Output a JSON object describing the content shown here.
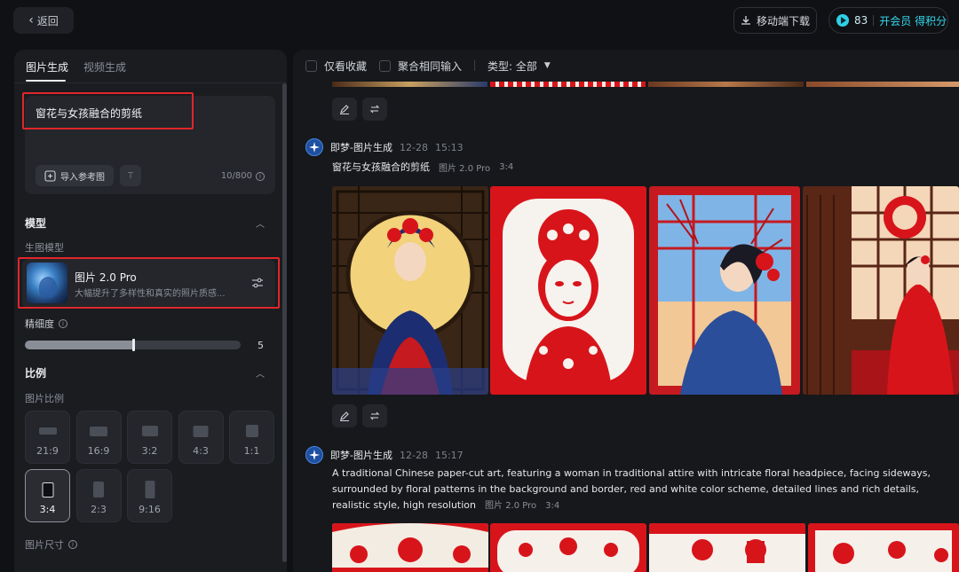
{
  "topbar": {
    "back_label": "返回",
    "mobile_download": "移动端下载",
    "credits": "83",
    "member_label": "开会员 得积分"
  },
  "left": {
    "tabs": [
      "图片生成",
      "视频生成"
    ],
    "prompt": "窗花与女孩融合的剪纸",
    "import_label": "导入参考图",
    "text_button": "T",
    "char_count": "10/800",
    "model_section": "模型",
    "model_sublabel": "生图模型",
    "model": {
      "name": "图片 2.0 Pro",
      "desc": "大幅提升了多样性和真实的照片质感..."
    },
    "detail_label": "精细度",
    "detail_value": "5",
    "detail_level": 0.5,
    "ratio_section": "比例",
    "ratio_sublabel": "图片比例",
    "ratios": [
      "21:9",
      "16:9",
      "3:2",
      "4:3",
      "1:1",
      "3:4",
      "2:3",
      "9:16"
    ],
    "ratio_selected": "3:4",
    "size_label": "图片尺寸"
  },
  "feed": {
    "filters": {
      "favorites": "仅看收藏",
      "group_same": "聚合相同输入",
      "type": "类型: 全部"
    },
    "generations": [
      {
        "author": "即梦-图片生成",
        "date": "12-28",
        "time": "15:13",
        "prompt": "窗花与女孩融合的剪纸",
        "model": "图片 2.0 Pro",
        "ratio": "3:4"
      },
      {
        "author": "即梦-图片生成",
        "date": "12-28",
        "time": "15:17",
        "prompt": "A traditional Chinese paper-cut art, featuring a woman in traditional attire with intricate floral headpiece, facing sideways, surrounded by floral patterns in the background and border, red and white color scheme, detailed lines and rich details, realistic style, high resolution",
        "model": "图片 2.0 Pro",
        "ratio": "3:4"
      }
    ]
  },
  "colors": {
    "background": "#101114",
    "panel": "#1a1c20",
    "accent_cyan": "#34d6ec",
    "highlight_red": "#e0262b",
    "papercut_red": "#d8141b"
  }
}
